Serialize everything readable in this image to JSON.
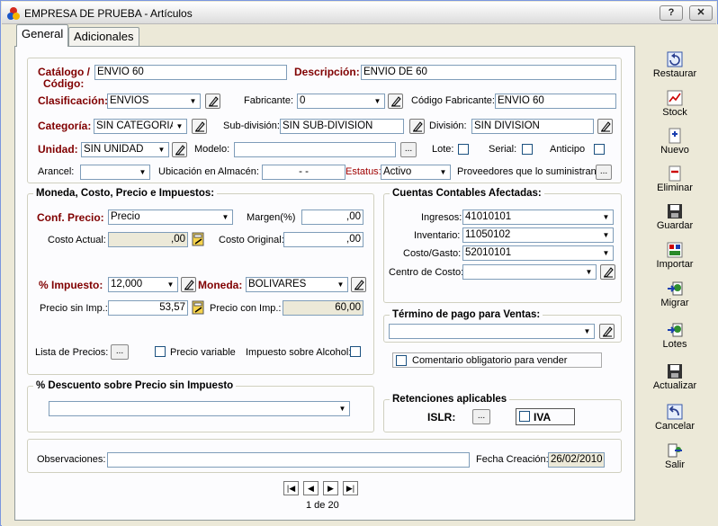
{
  "window": {
    "title": "EMPRESA DE PRUEBA - Artículos",
    "help": "?",
    "close": "✕"
  },
  "tabs": [
    {
      "label": "General"
    },
    {
      "label": "Adicionales"
    }
  ],
  "main": {
    "catalogo_label": "Catálogo /",
    "codigo_label": "Código:",
    "catalogo_value": "ENVIO 60",
    "descripcion_label": "Descripción:",
    "descripcion_value": "ENVIO  DE 60",
    "clasificacion_label": "Clasificación:",
    "clasificacion_value": "ENVIOS",
    "fabricante_label": "Fabricante:",
    "fabricante_value": "0",
    "codigo_fabricante_label": "Código Fabricante:",
    "codigo_fabricante_value": "ENVIO 60",
    "categoria_label": "Categoría:",
    "categoria_value": "SIN CATEGORIA",
    "subdivision_label": "Sub-división:",
    "subdivision_value": "SIN SUB-DIVISION",
    "division_label": "División:",
    "division_value": "SIN DIVISION",
    "unidad_label": "Unidad:",
    "unidad_value": "SIN UNIDAD",
    "modelo_label": "Modelo:",
    "modelo_value": "",
    "lote_label": "Lote:",
    "serial_label": "Serial:",
    "anticipo_label": "Anticipo",
    "arancel_label": "Arancel:",
    "arancel_value": "",
    "ubicacion_label": "Ubicación en Almacén:",
    "ubicacion_value": "-   -",
    "estatus_label": "Estatus:",
    "estatus_value": "Activo",
    "proveedores_label": "Proveedores que lo suministran:"
  },
  "moneda": {
    "title": "Moneda, Costo, Precio e Impuestos:",
    "conf_precio_label": "Conf. Precio:",
    "conf_precio_value": "Precio",
    "margen_label": "Margen(%)",
    "margen_value": ",00",
    "costo_actual_label": "Costo Actual:",
    "costo_actual_value": ",00",
    "costo_original_label": "Costo Original:",
    "costo_original_value": ",00",
    "impuesto_label": "% Impuesto:",
    "impuesto_value": "12,000",
    "moneda_label": "Moneda:",
    "moneda_value": "BOLIVARES",
    "precio_sin_label": "Precio sin Imp.:",
    "precio_sin_value": "53,57",
    "precio_con_label": "Precio con Imp.:",
    "precio_con_value": "60,00",
    "lista_precios_label": "Lista de Precios:",
    "precio_variable_label": "Precio variable",
    "impuesto_alcohol_label": "Impuesto sobre Alcohol:"
  },
  "cuentas": {
    "title": "Cuentas Contables Afectadas:",
    "ingresos_label": "Ingresos:",
    "ingresos_value": "41010101",
    "inventario_label": "Inventario:",
    "inventario_value": "11050102",
    "costo_gasto_label": "Costo/Gasto:",
    "costo_gasto_value": "52010101",
    "centro_costo_label": "Centro de Costo:",
    "centro_costo_value": ""
  },
  "termino": {
    "title": "Término de pago para Ventas:",
    "value": "",
    "comentario_label": "Comentario obligatorio para vender"
  },
  "descuento": {
    "title": "% Descuento sobre Precio sin Impuesto",
    "value": ""
  },
  "retenciones": {
    "title": "Retenciones aplicables",
    "islr_label": "ISLR:",
    "iva_label": "IVA"
  },
  "footer": {
    "observaciones_label": "Observaciones:",
    "observaciones_value": "",
    "fecha_label": "Fecha Creación:",
    "fecha_value": "26/02/2010"
  },
  "pager": {
    "text": "1 de 20"
  },
  "ellipsis": "...",
  "sidebar": [
    {
      "label": "Restaurar",
      "icon": "restore-icon"
    },
    {
      "label": "Stock",
      "icon": "chart-icon"
    },
    {
      "label": "Nuevo",
      "icon": "new-icon"
    },
    {
      "label": "Eliminar",
      "icon": "delete-icon"
    },
    {
      "label": "Guardar",
      "icon": "save-icon"
    },
    {
      "label": "Importar",
      "icon": "import-icon"
    },
    {
      "label": "Migrar",
      "icon": "migrate-icon"
    },
    {
      "label": "Lotes",
      "icon": "lots-icon"
    },
    {
      "label": "Actualizar",
      "icon": "update-icon"
    },
    {
      "label": "Cancelar",
      "icon": "cancel-icon"
    },
    {
      "label": "Salir",
      "icon": "exit-icon"
    }
  ]
}
